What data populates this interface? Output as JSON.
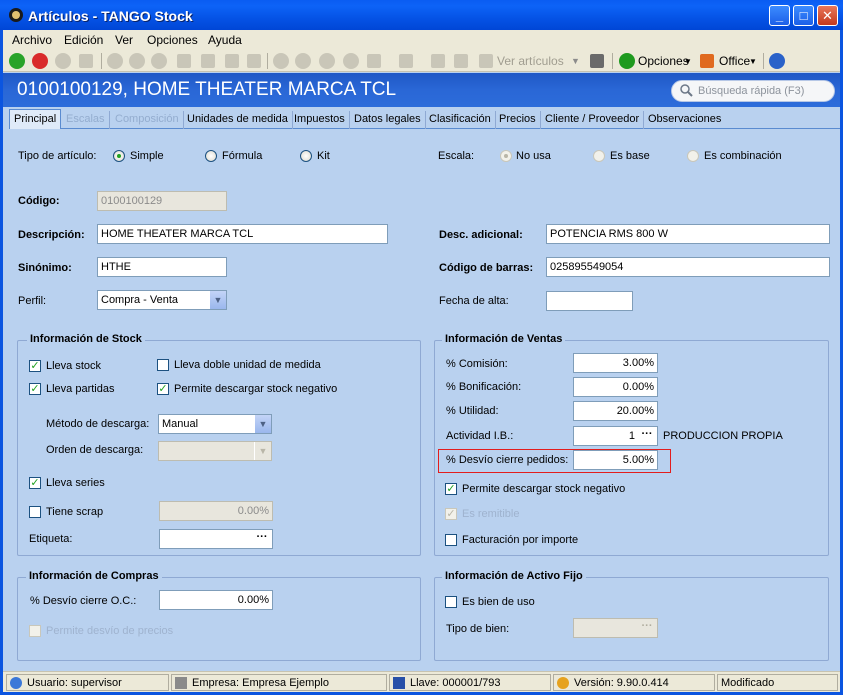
{
  "window": {
    "title": "Artículos - TANGO Stock"
  },
  "menu": [
    "Archivo",
    "Edición",
    "Ver",
    "Opciones",
    "Ayuda"
  ],
  "toolbar": {
    "view_articles": "Ver artículos",
    "options": "Opciones",
    "office": "Office"
  },
  "header": {
    "record_title": "0100100129, HOME THEATER MARCA TCL",
    "search_placeholder": "Búsqueda rápida (F3)"
  },
  "tabs": [
    {
      "label": "Principal",
      "state": "active"
    },
    {
      "label": "Escalas",
      "state": "disabled"
    },
    {
      "label": "Composición",
      "state": "disabled"
    },
    {
      "label": "Unidades de medida",
      "state": "normal"
    },
    {
      "label": "Impuestos",
      "state": "normal"
    },
    {
      "label": "Datos legales",
      "state": "normal"
    },
    {
      "label": "Clasificación",
      "state": "normal"
    },
    {
      "label": "Precios",
      "state": "normal"
    },
    {
      "label": "Cliente / Proveedor",
      "state": "normal"
    },
    {
      "label": "Observaciones",
      "state": "normal"
    }
  ],
  "tipo": {
    "label": "Tipo de artículo:",
    "options": [
      "Simple",
      "Fórmula",
      "Kit"
    ],
    "selected": "Simple"
  },
  "escala": {
    "label": "Escala:",
    "options": [
      "No usa",
      "Es base",
      "Es combinación"
    ],
    "selected": "No usa"
  },
  "fields": {
    "codigo_label": "Código:",
    "codigo": "0100100129",
    "descripcion_label": "Descripción:",
    "descripcion": "HOME THEATER MARCA TCL",
    "sinonimo_label": "Sinónimo:",
    "sinonimo": "HTHE",
    "perfil_label": "Perfil:",
    "perfil": "Compra - Venta",
    "desc_adicional_label": "Desc. adicional:",
    "desc_adicional": "POTENCIA  RMS 800 W",
    "codigo_barras_label": "Código de barras:",
    "codigo_barras": "025895549054",
    "fecha_alta_label": "Fecha de alta:",
    "fecha_alta": ""
  },
  "stock": {
    "title": "Información de Stock",
    "lleva_stock": "Lleva stock",
    "doble_unidad": "Lleva doble unidad de medida",
    "lleva_partidas": "Lleva partidas",
    "permite_negativo": "Permite descargar stock negativo",
    "metodo_label": "Método de descarga:",
    "metodo": "Manual",
    "orden_label": "Orden de descarga:",
    "orden": "",
    "lleva_series": "Lleva series",
    "tiene_scrap": "Tiene scrap",
    "scrap_value": "0.00%",
    "etiqueta_label": "Etiqueta:",
    "etiqueta": ""
  },
  "ventas": {
    "title": "Información de Ventas",
    "comision_label": "% Comisión:",
    "comision": "3.00%",
    "bonificacion_label": "% Bonificación:",
    "bonificacion": "0.00%",
    "utilidad_label": "% Utilidad:",
    "utilidad": "20.00%",
    "actividad_label": "Actividad I.B.:",
    "actividad": "1",
    "actividad_desc": "PRODUCCION PROPIA",
    "desvio_label": "% Desvío cierre pedidos:",
    "desvio": "5.00%",
    "permite_negativo": "Permite descargar stock negativo",
    "es_remitible": "Es remitible",
    "facturacion_importe": "Facturación por importe"
  },
  "compras": {
    "title": "Información de Compras",
    "desvio_label": "% Desvío cierre O.C.:",
    "desvio": "0.00%",
    "permite_desvio_precios": "Permite desvío de precios"
  },
  "activo": {
    "title": "Información de Activo Fijo",
    "es_bien_uso": "Es bien de uso",
    "tipo_bien_label": "Tipo de bien:",
    "tipo_bien": ""
  },
  "status": {
    "usuario": "Usuario: supervisor",
    "empresa": "Empresa: Empresa Ejemplo",
    "llave": "Llave: 000001/793",
    "version": "Versión: 9.90.0.414",
    "estado": "Modificado"
  },
  "colors": {
    "accent": "#0a5cf2",
    "highlight": "#e31d1d",
    "panel": "#b9d1ef"
  }
}
